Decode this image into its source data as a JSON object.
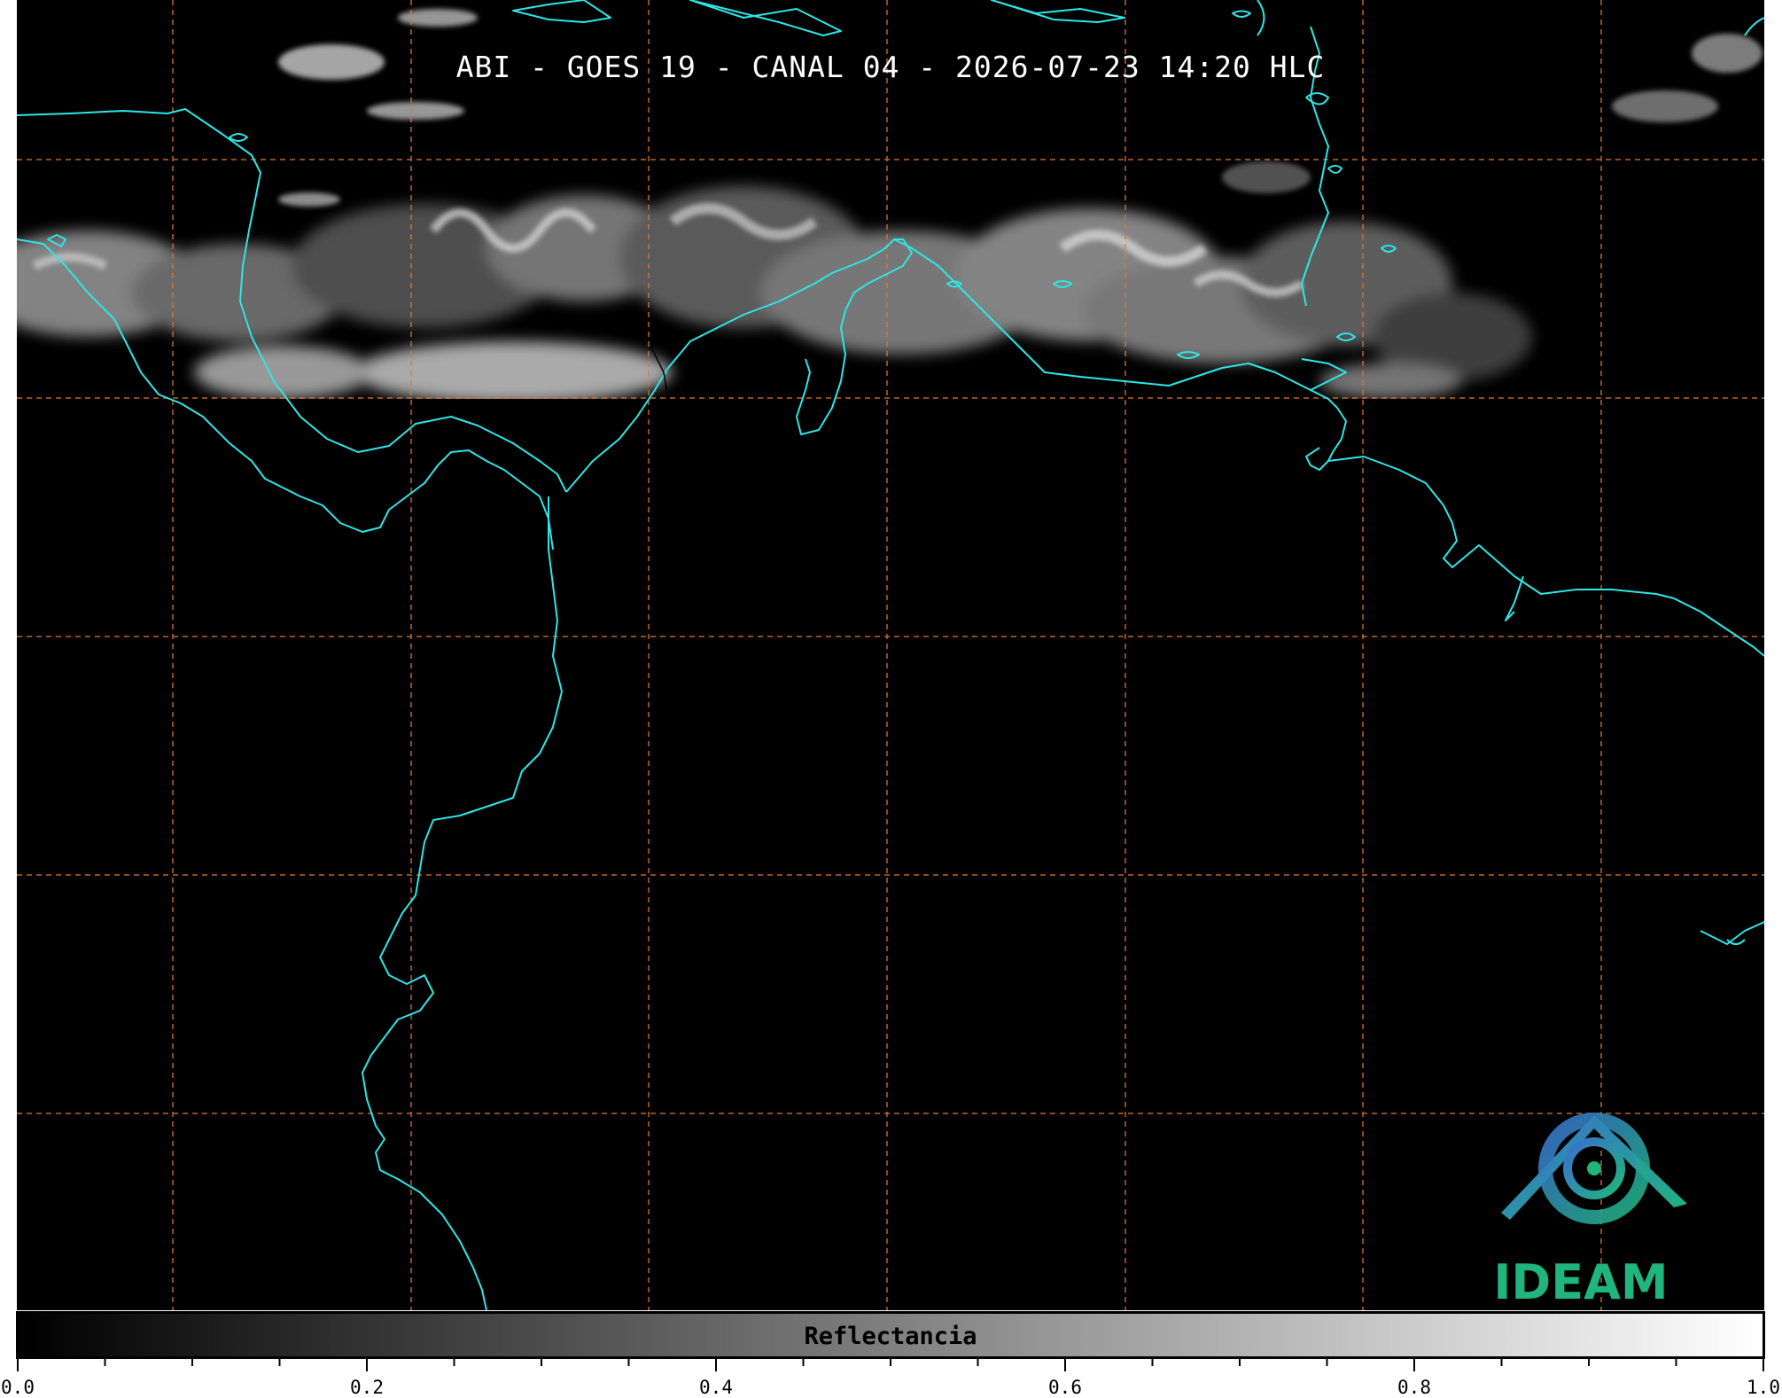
{
  "title": "ABI - GOES 19 - CANAL 04 - 2026-07-23 14:20 HLC",
  "logo": {
    "name": "IDEAM",
    "text": "IDEAM"
  },
  "colorbar": {
    "label": "Reflectancia",
    "min": 0.0,
    "max": 1.0,
    "tick_labels": [
      "0.0",
      "0.2",
      "0.4",
      "0.6",
      "0.8",
      "1.0"
    ],
    "major_ticks": [
      0.0,
      0.2,
      0.4,
      0.6,
      0.8,
      1.0
    ],
    "minor_ticks": [
      0.05,
      0.1,
      0.15,
      0.25,
      0.3,
      0.35,
      0.45,
      0.5,
      0.55,
      0.65,
      0.7,
      0.75,
      0.85,
      0.9,
      0.95
    ],
    "colors": {
      "start": "#000000",
      "end": "#ffffff"
    }
  },
  "map": {
    "background": "#000000",
    "coastline_color": "#2ee6e6",
    "gridline_color": "#e07830",
    "cloud_band": "bright clouds over northern portion, cut off at imaging edge",
    "gridlines": {
      "vertical_count": 7,
      "horizontal_count": 5,
      "style": "dashed"
    }
  }
}
